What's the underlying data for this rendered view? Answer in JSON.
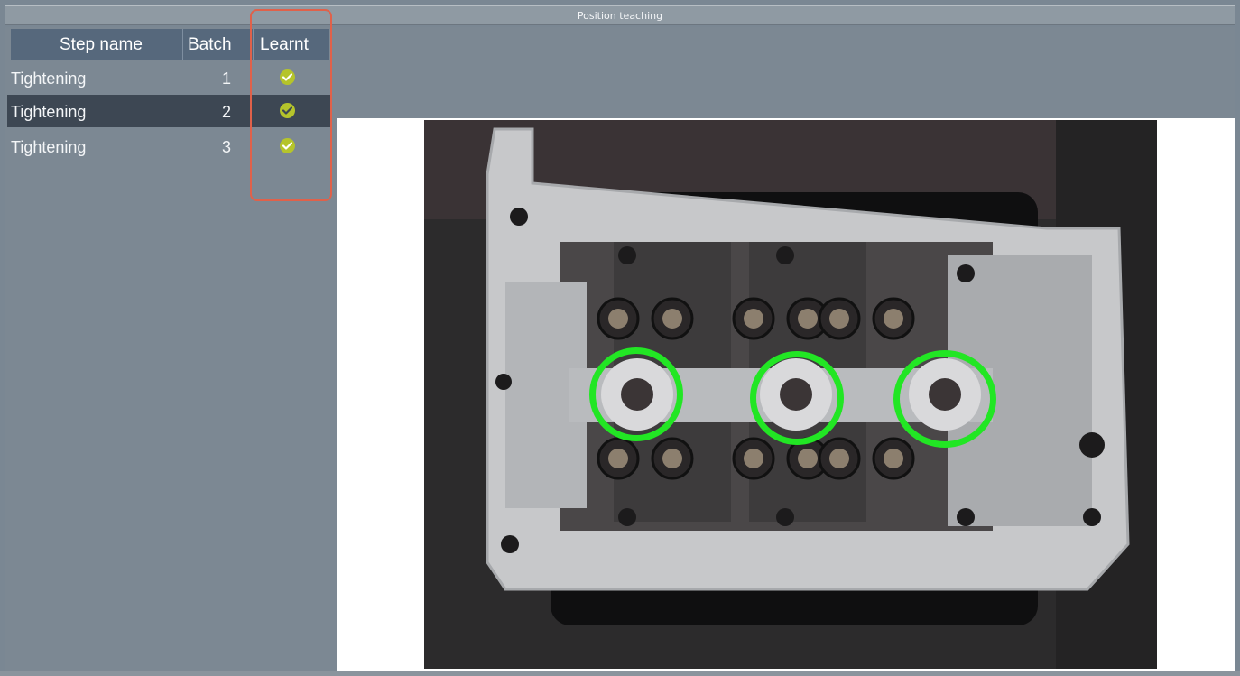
{
  "window": {
    "title": "Position teaching"
  },
  "steps_table": {
    "columns": [
      "Step name",
      "Batch",
      "Learnt"
    ],
    "rows": [
      {
        "step_name": "Tightening",
        "batch": "1",
        "learnt": true,
        "selected": false
      },
      {
        "step_name": "Tightening",
        "batch": "2",
        "learnt": true,
        "selected": true
      },
      {
        "step_name": "Tightening",
        "batch": "3",
        "learnt": true,
        "selected": false
      }
    ]
  },
  "image_view": {
    "learnt_position_markers": 3,
    "marker_color": "#22e624"
  },
  "colors": {
    "header_bg": "#56687c",
    "selected_row_bg": "#3d4753",
    "check_color": "#b5c42b",
    "highlight_border": "#e0614a"
  },
  "icons": [
    "check-circle-icon"
  ]
}
